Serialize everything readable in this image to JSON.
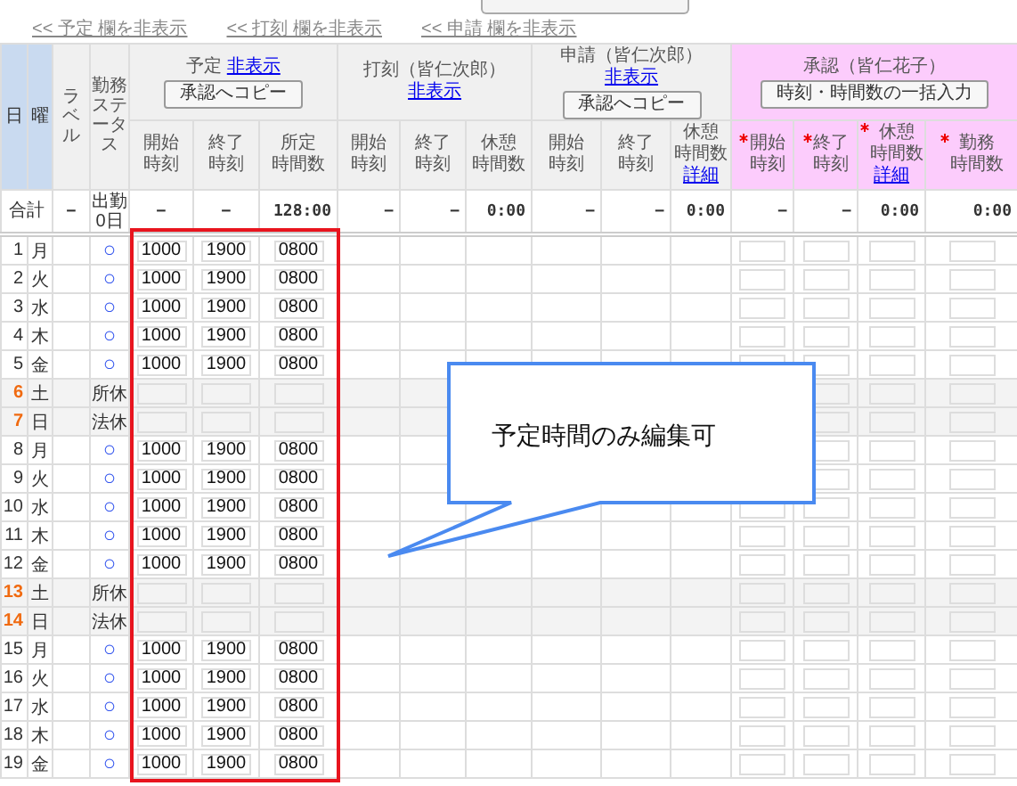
{
  "column_toggles": [
    "<< 予定 欄を非表示",
    "<< 打刻 欄を非表示",
    "<< 申請 欄を非表示"
  ],
  "fixed_headers": [
    "日",
    "曜",
    "ラベル",
    "勤務ステータス"
  ],
  "groups": [
    {
      "kind": "schedule",
      "title": "予定",
      "hide_link": "非表示",
      "button": "承認へコピー",
      "columns": [
        {
          "lines": [
            "開始",
            "時刻"
          ],
          "required": false
        },
        {
          "lines": [
            "終了",
            "時刻"
          ],
          "required": false
        },
        {
          "lines": [
            "所定",
            "時間数"
          ],
          "required": false
        }
      ]
    },
    {
      "kind": "stamp",
      "title": "打刻（皆仁次郎）",
      "hide_link": "非表示",
      "columns": [
        {
          "lines": [
            "開始",
            "時刻"
          ],
          "required": false
        },
        {
          "lines": [
            "終了",
            "時刻"
          ],
          "required": false
        },
        {
          "lines": [
            "休憩",
            "時間数"
          ],
          "required": false
        }
      ]
    },
    {
      "kind": "request",
      "title": "申請（皆仁次郎）",
      "hide_link": "非表示",
      "button": "承認へコピー",
      "columns": [
        {
          "lines": [
            "開始",
            "時刻"
          ],
          "required": false
        },
        {
          "lines": [
            "終了",
            "時刻"
          ],
          "required": false
        },
        {
          "lines": [
            "休憩",
            "時間数"
          ],
          "detail_link": "詳細",
          "required": false
        }
      ]
    },
    {
      "kind": "approval",
      "title": "承認（皆仁花子）",
      "button": "時刻・時間数の一括入力",
      "columns": [
        {
          "lines": [
            "開始",
            "時刻"
          ],
          "required": true
        },
        {
          "lines": [
            "終了",
            "時刻"
          ],
          "required": true
        },
        {
          "lines": [
            "休憩",
            "時間数"
          ],
          "detail_link": "詳細",
          "required": true
        },
        {
          "lines": [
            "勤務",
            "時間数"
          ],
          "required": true
        }
      ]
    }
  ],
  "total_row": {
    "label": "合計",
    "label_column": "−",
    "status_label": "出勤",
    "status_value": "0日",
    "values": [
      "−",
      "−",
      "128:00",
      "−",
      "−",
      "0:00",
      "−",
      "−",
      "0:00",
      "−",
      "−",
      "0:00",
      "0:00"
    ]
  },
  "rows": [
    {
      "day": "1",
      "weekday": "月",
      "kind": "workday",
      "status": "○",
      "start": "1000",
      "end": "1900",
      "hours": "0800"
    },
    {
      "day": "2",
      "weekday": "火",
      "kind": "workday",
      "status": "○",
      "start": "1000",
      "end": "1900",
      "hours": "0800"
    },
    {
      "day": "3",
      "weekday": "水",
      "kind": "workday",
      "status": "○",
      "start": "1000",
      "end": "1900",
      "hours": "0800"
    },
    {
      "day": "4",
      "weekday": "木",
      "kind": "workday",
      "status": "○",
      "start": "1000",
      "end": "1900",
      "hours": "0800"
    },
    {
      "day": "5",
      "weekday": "金",
      "kind": "workday",
      "status": "○",
      "start": "1000",
      "end": "1900",
      "hours": "0800"
    },
    {
      "day": "6",
      "weekday": "土",
      "kind": "holiday",
      "status": "所休"
    },
    {
      "day": "7",
      "weekday": "日",
      "kind": "holiday",
      "status": "法休"
    },
    {
      "day": "8",
      "weekday": "月",
      "kind": "workday",
      "status": "○",
      "start": "1000",
      "end": "1900",
      "hours": "0800"
    },
    {
      "day": "9",
      "weekday": "火",
      "kind": "workday",
      "status": "○",
      "start": "1000",
      "end": "1900",
      "hours": "0800"
    },
    {
      "day": "10",
      "weekday": "水",
      "kind": "workday",
      "status": "○",
      "start": "1000",
      "end": "1900",
      "hours": "0800"
    },
    {
      "day": "11",
      "weekday": "木",
      "kind": "workday",
      "status": "○",
      "start": "1000",
      "end": "1900",
      "hours": "0800"
    },
    {
      "day": "12",
      "weekday": "金",
      "kind": "workday",
      "status": "○",
      "start": "1000",
      "end": "1900",
      "hours": "0800"
    },
    {
      "day": "13",
      "weekday": "土",
      "kind": "holiday",
      "status": "所休"
    },
    {
      "day": "14",
      "weekday": "日",
      "kind": "holiday",
      "status": "法休"
    },
    {
      "day": "15",
      "weekday": "月",
      "kind": "workday",
      "status": "○",
      "start": "1000",
      "end": "1900",
      "hours": "0800"
    },
    {
      "day": "16",
      "weekday": "火",
      "kind": "workday",
      "status": "○",
      "start": "1000",
      "end": "1900",
      "hours": "0800"
    },
    {
      "day": "17",
      "weekday": "水",
      "kind": "workday",
      "status": "○",
      "start": "1000",
      "end": "1900",
      "hours": "0800"
    },
    {
      "day": "18",
      "weekday": "木",
      "kind": "workday",
      "status": "○",
      "start": "1000",
      "end": "1900",
      "hours": "0800"
    },
    {
      "day": "19",
      "weekday": "金",
      "kind": "workday",
      "status": "○",
      "start": "1000",
      "end": "1900",
      "hours": "0800"
    }
  ],
  "callout": "予定時間のみ編集可"
}
